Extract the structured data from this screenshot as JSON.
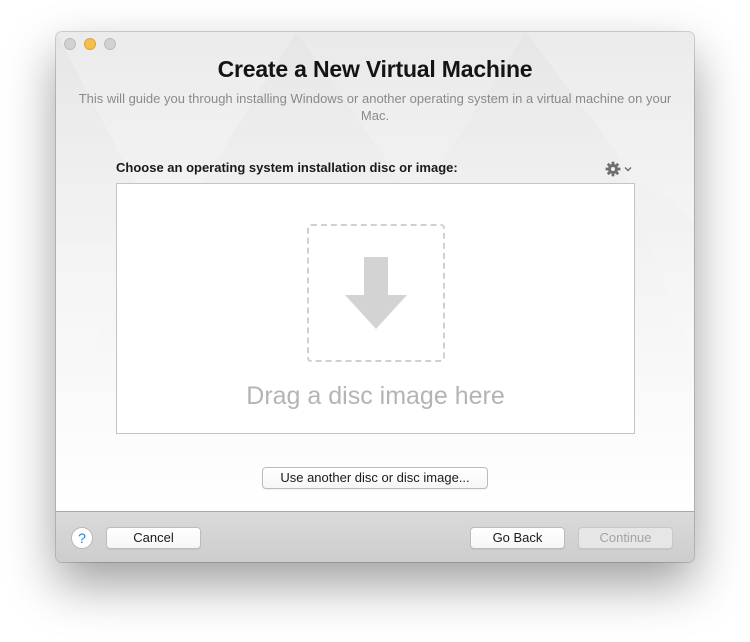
{
  "window": {
    "title": "Create a New Virtual Machine",
    "subtitle": "This will guide you through installing Windows or another operating system in a virtual machine on your Mac."
  },
  "install": {
    "section_label": "Choose an operating system installation disc or image:",
    "drop_hint": "Drag a disc image here",
    "other_disc_label": "Use another disc or disc image..."
  },
  "footer": {
    "help_label": "?",
    "cancel_label": "Cancel",
    "back_label": "Go Back",
    "continue_label": "Continue",
    "continue_enabled": false
  },
  "icons": {
    "gear": "gear-icon",
    "chevron": "chevron-down-icon",
    "drop_arrow": "arrow-down-icon",
    "help": "help-icon"
  },
  "colors": {
    "minimize_light": "#f5bf4f",
    "help_accent": "#2e7fd8",
    "disabled_text": "#a3a3a3"
  }
}
